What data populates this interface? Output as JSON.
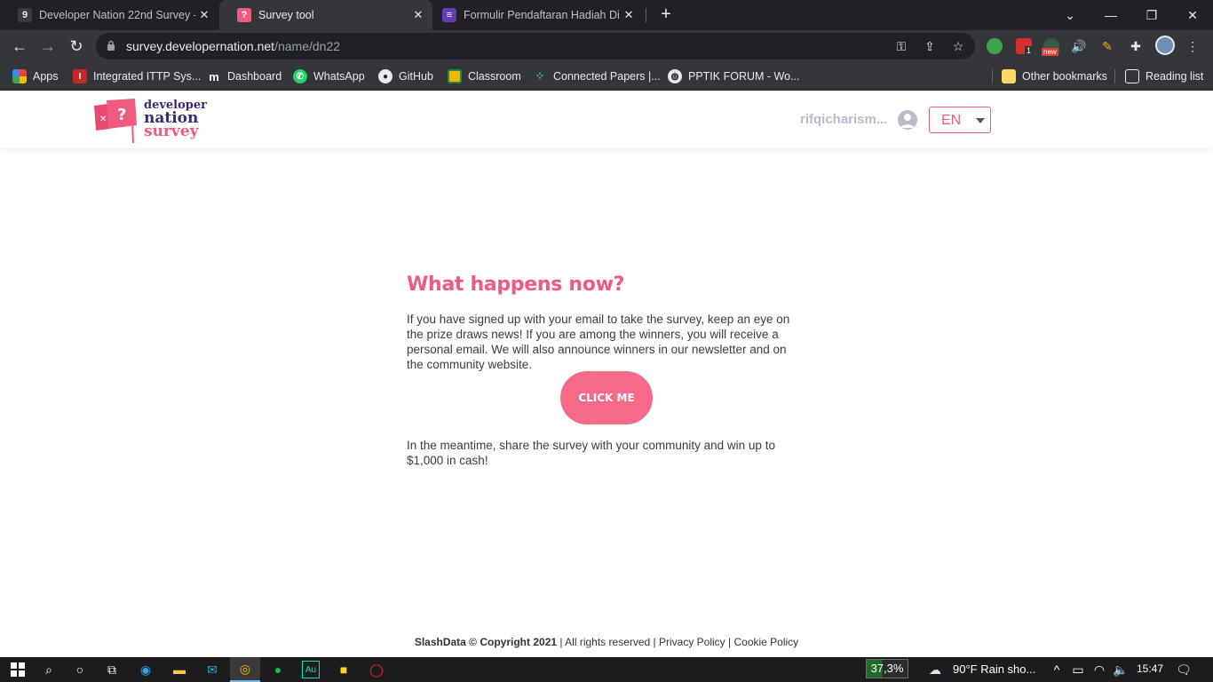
{
  "browser": {
    "tabs": [
      {
        "title": "Developer Nation 22nd Survey - ",
        "active": false,
        "favicon": "developer-nation-icon",
        "color": "#4a4a4a"
      },
      {
        "title": "Survey tool",
        "active": true,
        "favicon": "survey-tool-icon",
        "color": "#f05a7e"
      },
      {
        "title": "Formulir Pendaftaran Hadiah Dic",
        "active": false,
        "favicon": "google-forms-icon",
        "color": "#673ab7"
      }
    ],
    "url": {
      "host": "survey.developernation.net",
      "path": "/name/dn22"
    },
    "bookmarks": [
      {
        "label": "Apps",
        "icon": "apps-grid-icon",
        "color": "#ea4335"
      },
      {
        "label": "Integrated ITTP Sys...",
        "icon": "ittp-icon",
        "color": "#c62828"
      },
      {
        "label": "Dashboard",
        "icon": "moodle-icon",
        "color": "#35363a"
      },
      {
        "label": "WhatsApp",
        "icon": "whatsapp-icon",
        "color": "#25d366"
      },
      {
        "label": "GitHub",
        "icon": "github-icon",
        "color": "#35363a"
      },
      {
        "label": "Classroom",
        "icon": "classroom-icon",
        "color": "#f4b400"
      },
      {
        "label": "Connected Papers |...",
        "icon": "connected-papers-icon",
        "color": "#35363a"
      },
      {
        "label": "PPTIK FORUM - Wo...",
        "icon": "globe-icon",
        "color": "#35363a"
      }
    ],
    "other_bookmarks": "Other bookmarks",
    "reading_list": "Reading list",
    "extension_badges": {
      "count": "1",
      "new": "new"
    }
  },
  "site": {
    "logo": {
      "line1": "developer",
      "line2": "nation",
      "line3": "survey"
    },
    "username": "rifqicharism...",
    "language": "EN"
  },
  "main": {
    "heading": "What happens now?",
    "paragraph": "If you have signed up with your email to take the survey, keep an eye on the prize draws news! If you are among the winners, you will receive a personal email. We will also announce winners in our newsletter and on the community website.",
    "button_label": "CLICK ME",
    "paragraph2": "In the meantime, share the survey with your community and win up to $1,000 in cash!"
  },
  "footer": {
    "brand": "SlashData © Copyright 2021",
    "rights": " | All rights reserved | ",
    "privacy": "Privacy Policy",
    "sep": " | ",
    "cookie": "Cookie Policy"
  },
  "taskbar": {
    "battery": "37,3%",
    "weather": "90°F  Rain sho...",
    "time": "15:47"
  },
  "colors": {
    "accent": "#f05a7e",
    "button": "#f46a87",
    "brand_dark": "#3b2a73"
  }
}
